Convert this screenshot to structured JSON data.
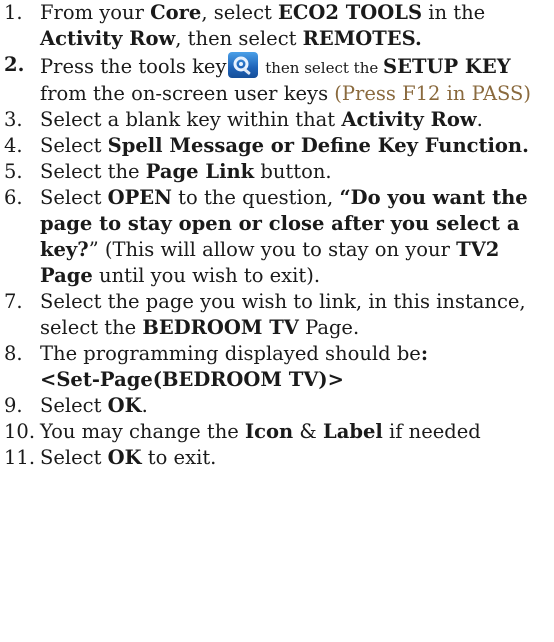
{
  "steps": [
    {
      "num": "1.",
      "parts": [
        {
          "t": "From your "
        },
        {
          "t": "Core",
          "b": true
        },
        {
          "t": ", select "
        },
        {
          "t": "ECO2 TOOLS",
          "b": true
        },
        {
          "t": " in the "
        },
        {
          "t": "Activity Row",
          "b": true
        },
        {
          "t": ", then select "
        },
        {
          "t": "REMOTES.",
          "b": true
        }
      ]
    },
    {
      "num": "2.",
      "numBold": true,
      "parts": [
        {
          "t": "Press the tools key"
        },
        {
          "icon": "tools-key-icon"
        },
        {
          "t": " then select the ",
          "small": true
        },
        {
          "t": "SETUP KEY",
          "b": true
        },
        {
          "t": " from the on-screen user keys "
        },
        {
          "t": "(Press F12 in PASS)",
          "tan": true
        }
      ]
    },
    {
      "num": "3.",
      "parts": [
        {
          "t": "Select a blank key within that "
        },
        {
          "t": "Activity Row",
          "b": true
        },
        {
          "t": "."
        }
      ]
    },
    {
      "num": "4.",
      "parts": [
        {
          "t": "Select "
        },
        {
          "t": "Spell Message or Define Key Function.",
          "b": true
        }
      ]
    },
    {
      "num": "5.",
      "parts": [
        {
          "t": "Select the "
        },
        {
          "t": "Page Link",
          "b": true
        },
        {
          "t": " button."
        }
      ]
    },
    {
      "num": "6.",
      "parts": [
        {
          "t": "Select "
        },
        {
          "t": "OPEN",
          "b": true
        },
        {
          "t": " to the question, "
        },
        {
          "t": "“Do you want the page to stay open or close after you select a key?",
          "b": true
        },
        {
          "t": "” (This will allow you to stay on your "
        },
        {
          "t": "TV2 Page",
          "b": true
        },
        {
          "t": " until you wish to exit)."
        }
      ]
    },
    {
      "num": "7.",
      "parts": [
        {
          "t": "Select the page you wish to link, in this instance, select the "
        },
        {
          "t": "BEDROOM TV",
          "b": true
        },
        {
          "t": " Page."
        }
      ]
    },
    {
      "num": "8.",
      "parts": [
        {
          "t": "The programming displayed should be"
        },
        {
          "t": ":",
          "b": true
        },
        {
          "br": true
        },
        {
          "t": "<Set-Page(BEDROOM TV)>",
          "b": true
        }
      ]
    },
    {
      "num": "9.",
      "parts": [
        {
          "t": "Select "
        },
        {
          "t": "OK",
          "b": true
        },
        {
          "t": "."
        }
      ]
    },
    {
      "num": "10.",
      "parts": [
        {
          "t": "You may change the "
        },
        {
          "t": "Icon",
          "b": true
        },
        {
          "t": " & "
        },
        {
          "t": "Label",
          "b": true
        },
        {
          "t": " if needed"
        }
      ]
    },
    {
      "num": "11.",
      "parts": [
        {
          "t": "Select "
        },
        {
          "t": "OK",
          "b": true
        },
        {
          "t": " to exit."
        }
      ]
    }
  ],
  "colors": {
    "text": "#1a1a1a",
    "note": "#8a6a3e",
    "icon": "#1f63b8"
  }
}
